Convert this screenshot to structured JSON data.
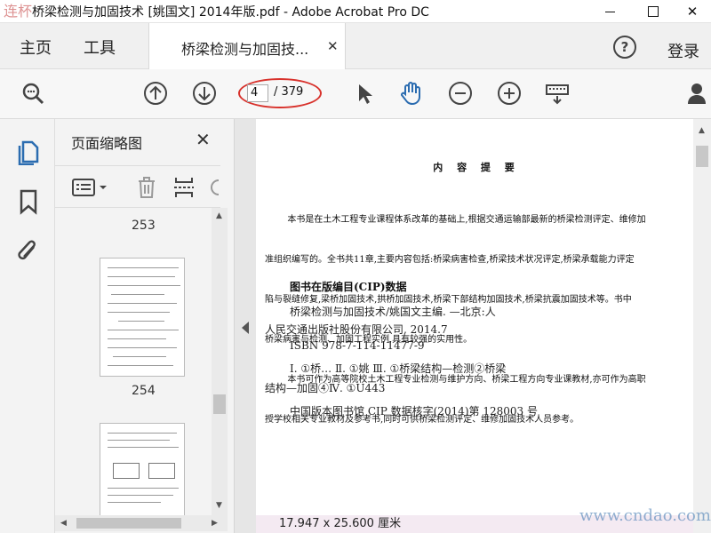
{
  "window": {
    "title": "桥梁检测与加固技术 [姚国文] 2014年版.pdf - Adobe Acrobat Pro DC",
    "logo_text": "连杯网",
    "close_glyph": "✕"
  },
  "menu": {
    "home": "主页",
    "tools": "工具",
    "doc_tab_label": "桥梁检测与加固技...",
    "doc_tab_close": "✕",
    "help": "?",
    "login": "登录"
  },
  "toolbar": {
    "current_page": "4",
    "total_pages": "/ 379",
    "icons": [
      "zoom-icon",
      "page-up-icon",
      "page-down-icon",
      "select-arrow-icon",
      "hand-icon",
      "zoom-out-icon",
      "zoom-in-icon",
      "scroll-keyboard-icon",
      "user-icon"
    ],
    "highlight_color": "#d8322c",
    "accent": "#2b6cb0"
  },
  "thumbnails": {
    "title": "页面缩略图",
    "close": "✕",
    "pages": [
      {
        "label": "253"
      },
      {
        "label": "254"
      }
    ]
  },
  "document": {
    "heading": "内 容 提 要",
    "summary_lines": [
      "        本书是在土木工程专业课程体系改革的基础上,根据交通运输部最新的桥梁检测评定、维修加",
      "准组织编写的。全书共11章,主要内容包括:桥梁病害检查,桥梁技术状况评定,桥梁承载能力评定",
      "陷与裂缝修复,梁桥加固技术,拱桥加固技术,桥梁下部结构加固技术,桥梁抗震加固技术等。书中",
      "桥梁病害与检测、加固工程实例,具有较强的实用性。",
      "        本书可作为高等院校土木工程专业检测与维护方向、桥梁工程方向专业课教材,亦可作为高职",
      "授学校相关专业教材及参考书,同时可供桥梁检测评定、维修加固技术人员参考。"
    ],
    "cip_title": "图书在版编目(CIP)数据",
    "cip_lines": [
      "桥梁检测与加固技术/姚国文主编. —北京:人",
      "人民交通出版社股份有限公司, 2014.7",
      "ISBN 978-7-114-11477-9",
      "Ⅰ. ①桥…  Ⅱ. ①姚  Ⅲ. ①桥梁结构—检测②桥梁",
      "结构—加固④Ⅳ. ①U443",
      "中国版本图书馆 CIP 数据核字(2014)第 128003 号"
    ],
    "page_size": "17.947 x 25.600 厘米"
  },
  "watermark": "www.cndao.com"
}
